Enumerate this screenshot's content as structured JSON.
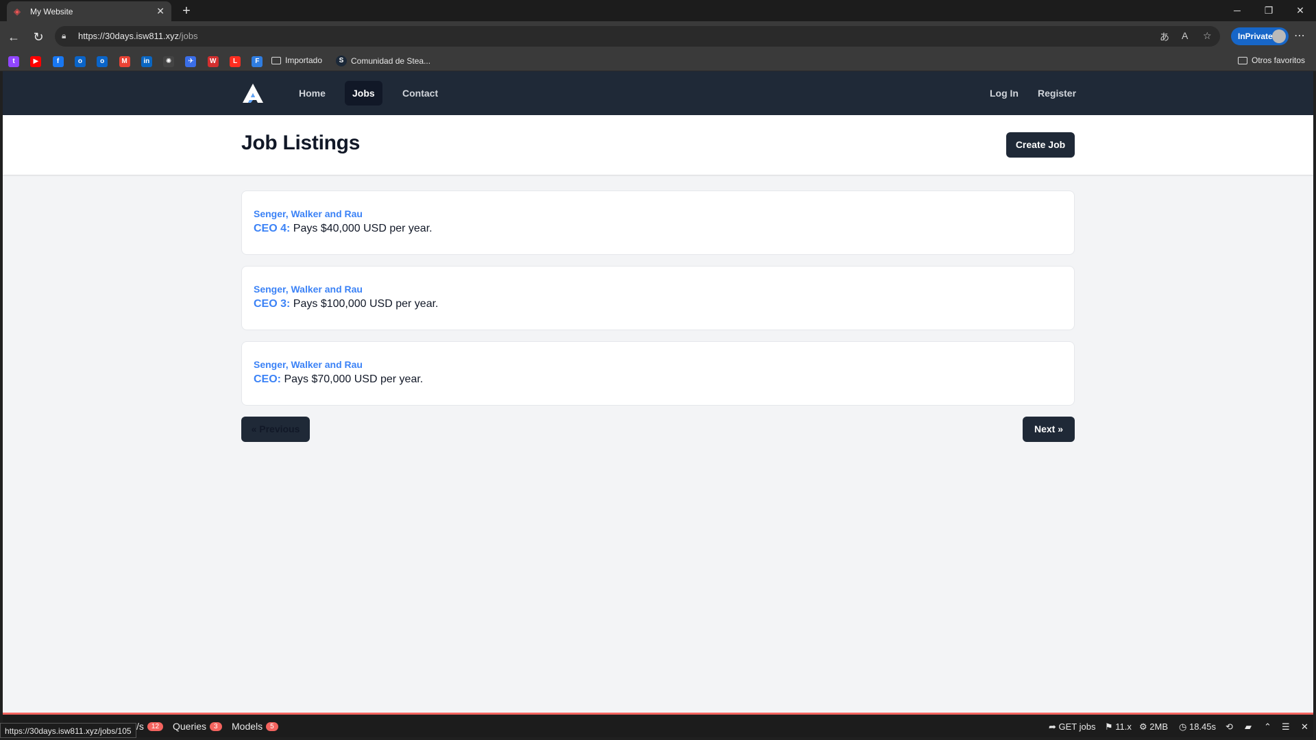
{
  "browser": {
    "tab_title": "My Website",
    "tab_close": "✕",
    "new_tab": "+",
    "url_host": "https://30days.isw811.xyz",
    "url_path": "/jobs",
    "inprivate_label": "InPrivate",
    "bookmarks": [
      {
        "icon": "twitch-icon",
        "color": "#9146ff"
      },
      {
        "icon": "youtube-icon",
        "color": "#ff0000"
      },
      {
        "icon": "facebook-icon",
        "color": "#1877f2"
      },
      {
        "icon": "outlook-icon",
        "color": "#0a64c8"
      },
      {
        "icon": "outlook-icon",
        "color": "#0a64c8"
      },
      {
        "icon": "gmail-icon",
        "color": "#ea4335"
      },
      {
        "icon": "linkedin-icon",
        "color": "#0a66c2"
      },
      {
        "icon": "openai-icon",
        "color": "#444444"
      },
      {
        "icon": "bird-icon",
        "color": "#3a6ee8"
      },
      {
        "icon": "w-icon",
        "color": "#d32f2f"
      },
      {
        "icon": "laravel-icon",
        "color": "#ff2d20"
      },
      {
        "icon": "f-icon",
        "color": "#2f7de1"
      }
    ],
    "bookmark_importado": "Importado",
    "bookmark_steam": "Comunidad de Stea...",
    "bookmark_otros": "Otros favoritos"
  },
  "site": {
    "nav": {
      "home": "Home",
      "jobs": "Jobs",
      "contact": "Contact",
      "login": "Log In",
      "register": "Register"
    },
    "page_title": "Job Listings",
    "create_job": "Create Job",
    "jobs": [
      {
        "employer": "Senger, Walker and Rau",
        "title": "CEO 4:",
        "pay": "Pays $40,000 USD per year."
      },
      {
        "employer": "Senger, Walker and Rau",
        "title": "CEO 3:",
        "pay": "Pays $100,000 USD per year."
      },
      {
        "employer": "Senger, Walker and Rau",
        "title": "CEO:",
        "pay": "Pays $70,000 USD per year."
      }
    ],
    "pagination": {
      "previous": "« Previous",
      "next": "Next »"
    }
  },
  "debugbar": {
    "status_url": "https://30days.isw811.xyz/jobs/105",
    "views_suffix": "/s",
    "views_count": "12",
    "queries_label": "Queries",
    "queries_count": "3",
    "models_label": "Models",
    "models_count": "5",
    "route": "GET jobs",
    "php_version": "11.x",
    "memory": "2MB",
    "time": "18.45s"
  }
}
